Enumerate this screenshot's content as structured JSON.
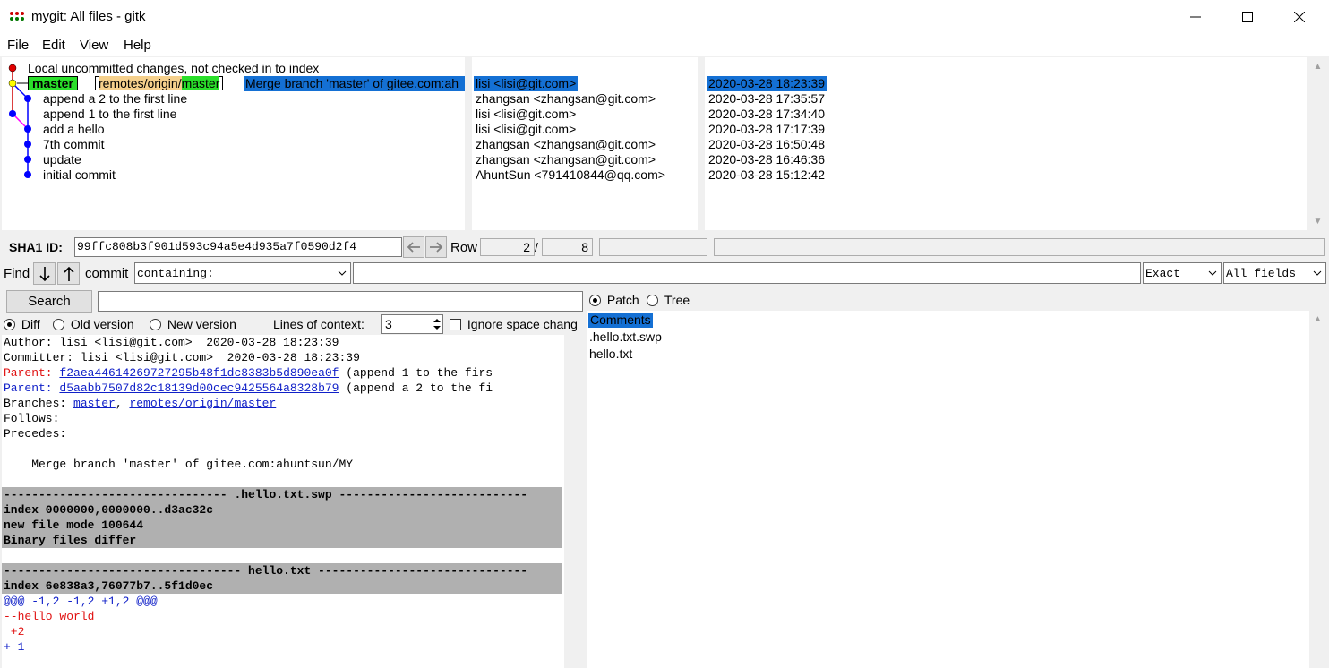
{
  "window": {
    "title": "mygit: All files - gitk",
    "controls": [
      "minimize-icon",
      "maximize-icon",
      "close-icon"
    ]
  },
  "menu": [
    "File",
    "Edit",
    "View",
    "Help"
  ],
  "commits": {
    "uncommitted": "Local uncommitted changes, not checked in to index",
    "head": {
      "branch": "master",
      "remote_prefix": "remotes/origin/",
      "remote_branch": "master",
      "subject": "Merge branch 'master' of gitee.com:ah",
      "author": "lisi <lisi@git.com>",
      "date": "2020-03-28 18:23:39"
    },
    "rows": [
      {
        "subject": "append a 2 to the first line",
        "author": "zhangsan <zhangsan@git.com>",
        "date": "2020-03-28 17:35:57"
      },
      {
        "subject": "append 1 to the first line",
        "author": "lisi <lisi@git.com>",
        "date": "2020-03-28 17:34:40"
      },
      {
        "subject": "add a hello",
        "author": "lisi <lisi@git.com>",
        "date": "2020-03-28 17:17:39"
      },
      {
        "subject": "7th commit",
        "author": "zhangsan <zhangsan@git.com>",
        "date": "2020-03-28 16:50:48"
      },
      {
        "subject": "update",
        "author": "zhangsan <zhangsan@git.com>",
        "date": "2020-03-28 16:46:36"
      },
      {
        "subject": "initial commit",
        "author": "AhuntSun <791410844@qq.com>",
        "date": "2020-03-28 15:12:42"
      }
    ]
  },
  "sha": {
    "label": "SHA1 ID:",
    "value": "99ffc808b3f901d593c94a5e4d935a7f0590d2f4",
    "row_label": "Row",
    "row_current": "2",
    "row_sep": "/",
    "row_total": "8"
  },
  "find": {
    "label": "Find",
    "type": "commit",
    "mode": "containing:",
    "match": "Exact",
    "fields": "All fields"
  },
  "search": {
    "button": "Search",
    "value": ""
  },
  "diff_options": {
    "diff": "Diff",
    "old": "Old version",
    "new": "New version",
    "context_label": "Lines of context:",
    "context_value": "3",
    "ignore_space": "Ignore space chang"
  },
  "view_mode": {
    "patch": "Patch",
    "tree": "Tree"
  },
  "details": {
    "author": "Author: lisi <lisi@git.com>  2020-03-28 18:23:39",
    "committer": "Committer: lisi <lisi@git.com>  2020-03-28 18:23:39",
    "parent1_label": "Parent: ",
    "parent1_sha": "f2aea44614269727295b48f1dc8383b5d890ea0f",
    "parent1_msg": " (append 1 to the firs",
    "parent2_label": "Parent: ",
    "parent2_sha": "d5aabb7507d82c18139d00cec9425564a8328b79",
    "parent2_msg": " (append a 2 to the fi",
    "branches_label": "Branches: ",
    "branch1": "master",
    "branch_sep": ", ",
    "branch2": "remotes/origin/master",
    "follows": "Follows:",
    "precedes": "Precedes:",
    "message": "    Merge branch 'master' of gitee.com:ahuntsun/MY",
    "file1_header": "-------------------------------- .hello.txt.swp ---------------------------",
    "file1_index": "index 0000000,0000000..d3ac32c",
    "file1_mode": "new file mode 100644",
    "file1_binary": "Binary files differ",
    "file2_header": "---------------------------------- hello.txt ------------------------------",
    "file2_index": "index 6e838a3,76077b7..5f1d0ec",
    "hunk": "@@@ -1,2 -1,2 +1,2 @@@",
    "line_removed": "--hello world",
    "line_added1": " +2",
    "line_added2": "+ 1"
  },
  "file_list": [
    "Comments",
    ".hello.txt.swp",
    "hello.txt"
  ],
  "colors": {
    "selection": "#1470d4",
    "local_branch": "#2adf2a",
    "remote_prefix": "#f5d08c",
    "graph_line_red": "#d00000",
    "graph_line_blue": "#0000ff",
    "graph_line_magenta": "#ff00ff",
    "diff_header": "#b0b0b0"
  }
}
